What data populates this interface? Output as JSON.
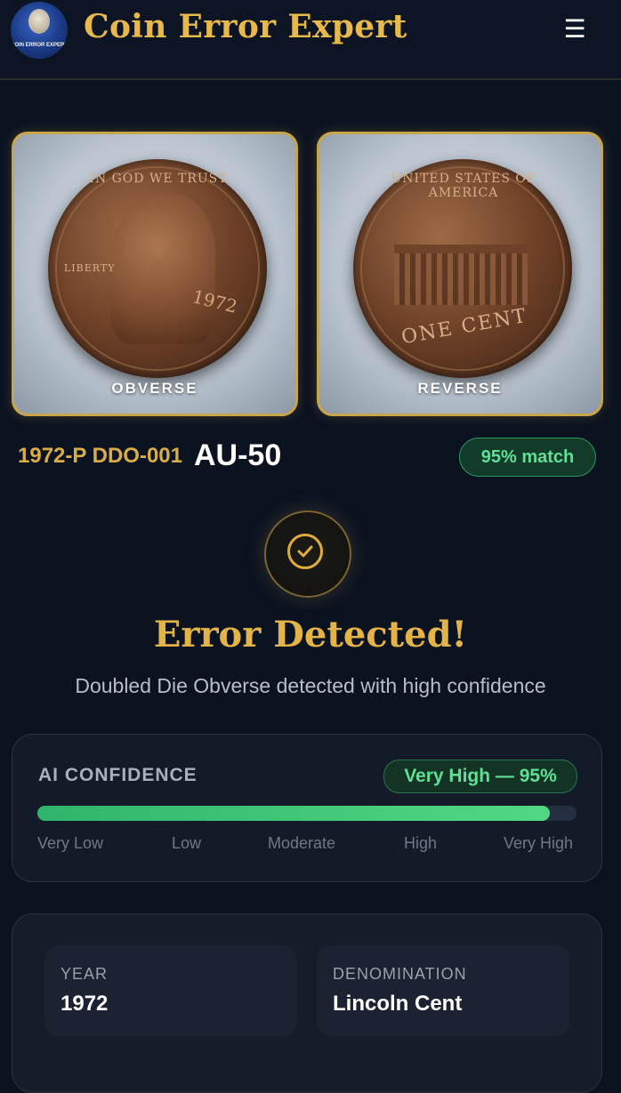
{
  "header": {
    "logo_text": "COIN ERROR EXPERT",
    "brand": "Coin Error Expert",
    "menu_icon": "menu-icon"
  },
  "images": {
    "obverse_label": "OBVERSE",
    "reverse_label": "REVERSE",
    "obverse_legend": "IN GOD WE TRUST",
    "obverse_liberty": "LIBERTY",
    "obverse_date": "1972",
    "reverse_legend": "UNITED STATES OF AMERICA",
    "reverse_denomination": "ONE CENT"
  },
  "result": {
    "variety": "1972-P DDO-001",
    "grade": "AU-50",
    "match": "95% match"
  },
  "detection": {
    "title": "Error Detected!",
    "subtitle": "Doubled Die Obverse detected with high confidence"
  },
  "confidence": {
    "title": "AI CONFIDENCE",
    "badge": "Very High — 95%",
    "level": 0.95,
    "scale": [
      "Very Low",
      "Low",
      "Moderate",
      "High",
      "Very High"
    ]
  },
  "details": {
    "year_label": "YEAR",
    "year_value": "1972",
    "denomination_label": "DENOMINATION",
    "denomination_value": "Lincoln Cent"
  },
  "colors": {
    "accent_gold": "#e3b347",
    "success_green": "#5fe096",
    "background": "#0b1220"
  }
}
